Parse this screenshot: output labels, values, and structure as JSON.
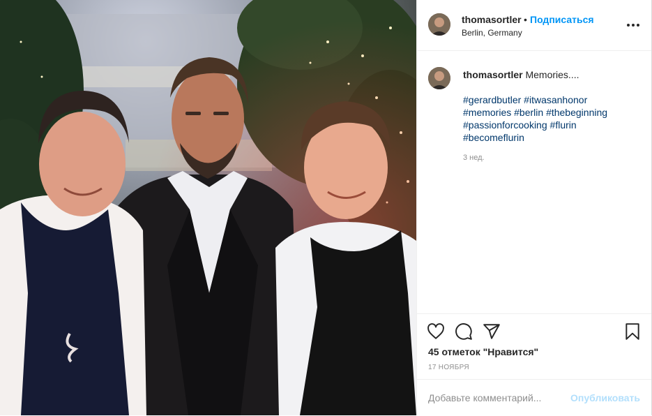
{
  "post": {
    "photo_alt": "Three men posing outdoors at night: two chefs in aprons and a bearded man in a suit vest"
  },
  "header": {
    "username": "thomasortler",
    "dot": "•",
    "follow_label": "Подписаться",
    "location": "Berlin, Germany",
    "more_icon": "more-horizontal-icon"
  },
  "caption": {
    "username": "thomasortler",
    "text": "Memories....",
    "hashtags": [
      "#gerardbutler",
      "#itwasanhonor",
      "#memories",
      "#berlin",
      "#thebeginning",
      "#passionforcooking",
      "#flurin",
      "#becomeflurin"
    ],
    "time_ago": "3 нед."
  },
  "actions": {
    "like_icon": "heart-icon",
    "comment_icon": "comment-icon",
    "share_icon": "share-icon",
    "save_icon": "bookmark-icon"
  },
  "likes_text": "45 отметок \"Нравится\"",
  "date": "17 НОЯБРЯ",
  "comment": {
    "placeholder": "Добавьте комментарий...",
    "publish_label": "Опубликовать"
  },
  "colors": {
    "accent": "#0095f6",
    "link": "#00376b",
    "muted": "#8e8e8e",
    "publish_disabled": "#b2dffc"
  }
}
